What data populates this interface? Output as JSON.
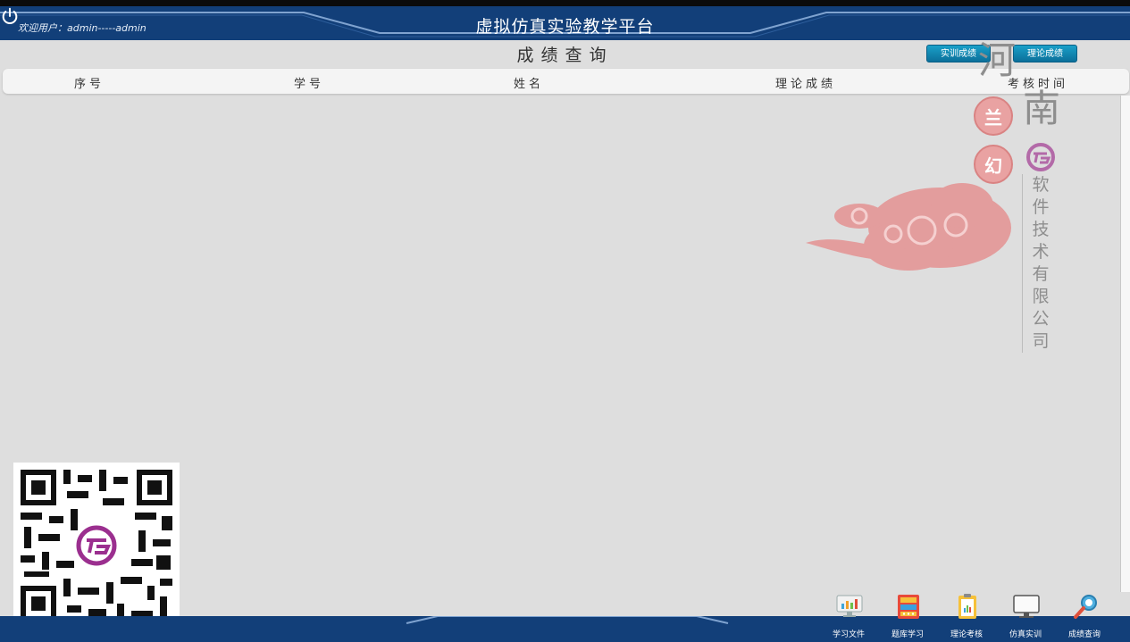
{
  "header": {
    "welcome": "欢迎用户：admin-----admin",
    "title": "虚拟仿真实验教学平台",
    "power_icon": "power-icon"
  },
  "page": {
    "title": "成绩查询",
    "buttons": {
      "practical": "实训成绩",
      "theory": "理论成绩"
    }
  },
  "table": {
    "columns": [
      "序号",
      "学号",
      "姓名",
      "理论成绩",
      "考核时间"
    ],
    "rows": []
  },
  "watermark": {
    "province": [
      "河",
      "南"
    ],
    "seals": [
      "兰",
      "幻"
    ],
    "company_chars": [
      "软",
      "件",
      "技",
      "术",
      "有",
      "限",
      "公",
      "司"
    ],
    "seal_color": "#e9a2a2"
  },
  "bottom_nav": [
    {
      "label": "学习文件",
      "icon": "study-files-icon"
    },
    {
      "label": "题库学习",
      "icon": "question-bank-icon"
    },
    {
      "label": "理论考核",
      "icon": "theory-exam-icon"
    },
    {
      "label": "仿真实训",
      "icon": "simulation-training-icon"
    },
    {
      "label": "成绩查询",
      "icon": "score-query-icon"
    }
  ],
  "colors": {
    "header_bg": "#123f79",
    "accent_button": "#1aa0c8",
    "background": "#dedede"
  }
}
